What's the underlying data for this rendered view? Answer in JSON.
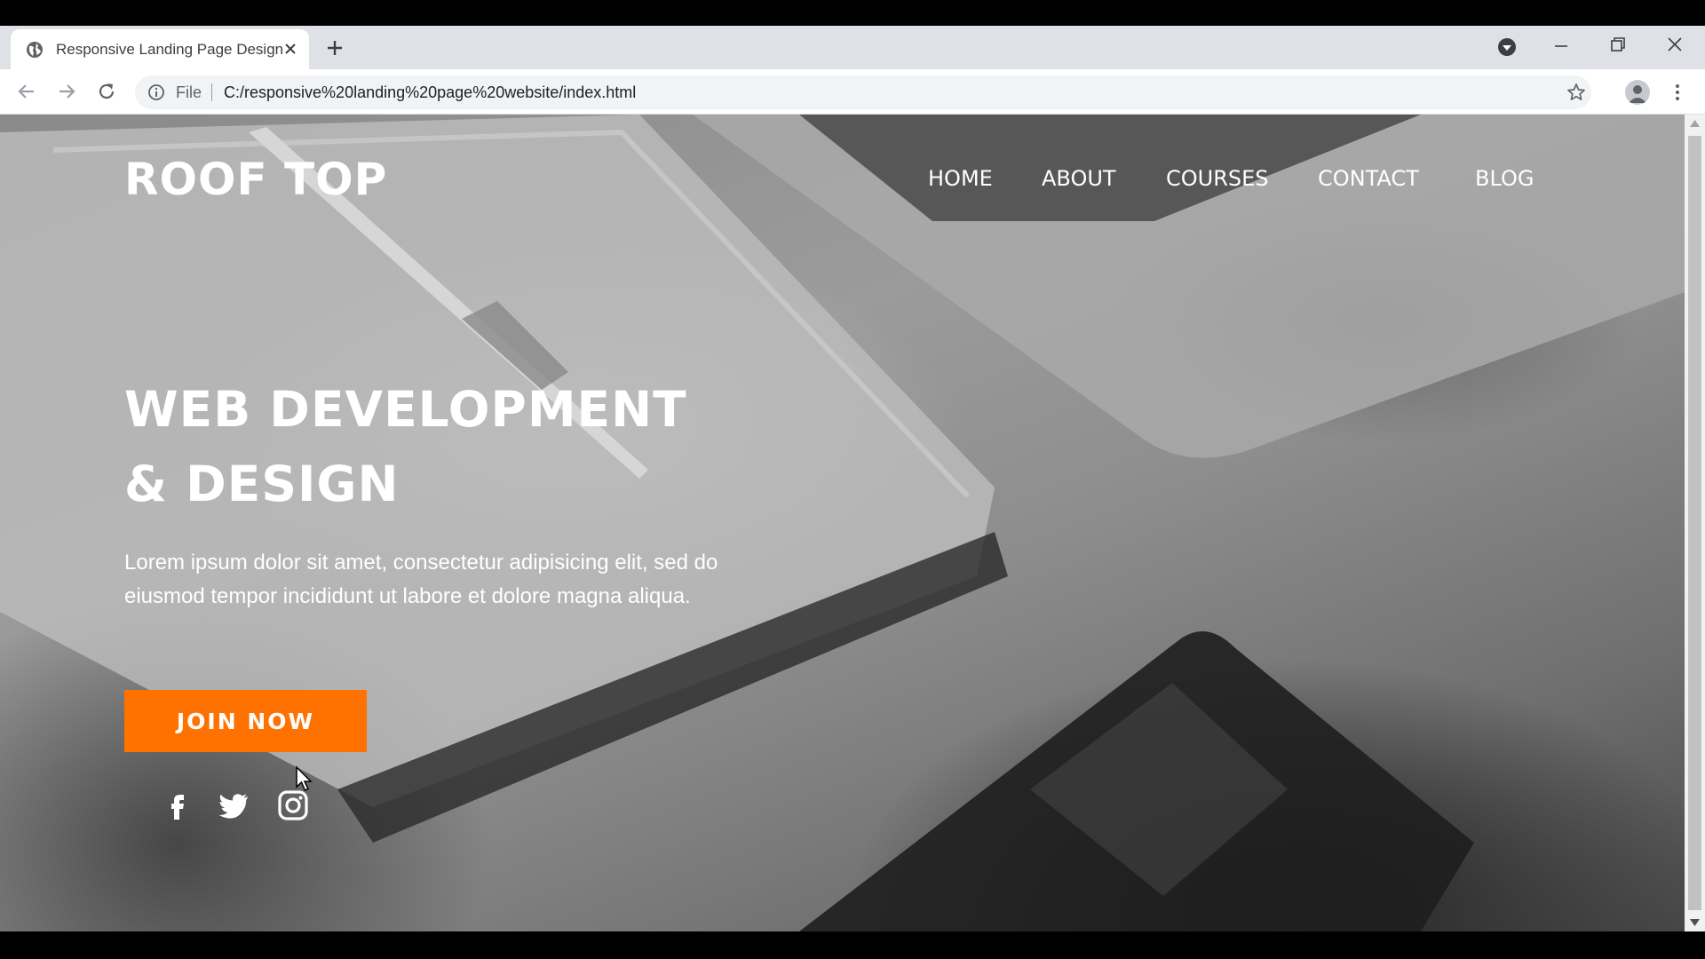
{
  "browser": {
    "tab_title": "Responsive Landing Page Design",
    "address_scheme_label": "File",
    "address_url": "C:/responsive%20landing%20page%20website/index.html"
  },
  "site": {
    "logo": "ROOF TOP",
    "nav": [
      "HOME",
      "ABOUT",
      "COURSES",
      "CONTACT",
      "BLOG"
    ],
    "hero_title_line1": "WEB DEVELOPMENT",
    "hero_title_line2": "& DESIGN",
    "hero_text": "Lorem ipsum dolor sit amet, consectetur adipisicing elit, sed do eiusmod tempor incididunt ut labore et dolore magna aliqua.",
    "cta_label": "JOIN NOW",
    "social": [
      "facebook-icon",
      "twitter-icon",
      "instagram-icon"
    ]
  },
  "colors": {
    "accent": "#ff7200",
    "text": "#ffffff"
  }
}
